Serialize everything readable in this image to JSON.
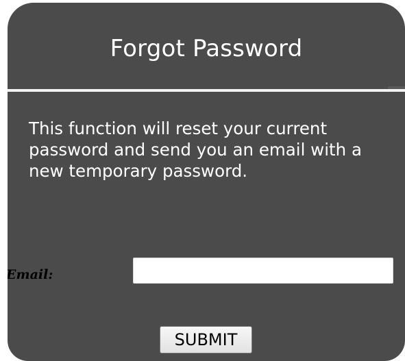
{
  "dialog": {
    "title": "Forgot Password",
    "description": "This function will reset your current password and send you an email with a new temporary password.",
    "email_label": "Email:",
    "email_value": "",
    "email_placeholder": "",
    "submit_label": "SUBMIT"
  },
  "colors": {
    "panel_background": "#4b4b4b",
    "title_text": "#ffffff",
    "divider": "#f3f3f3",
    "label_text": "#000000"
  }
}
